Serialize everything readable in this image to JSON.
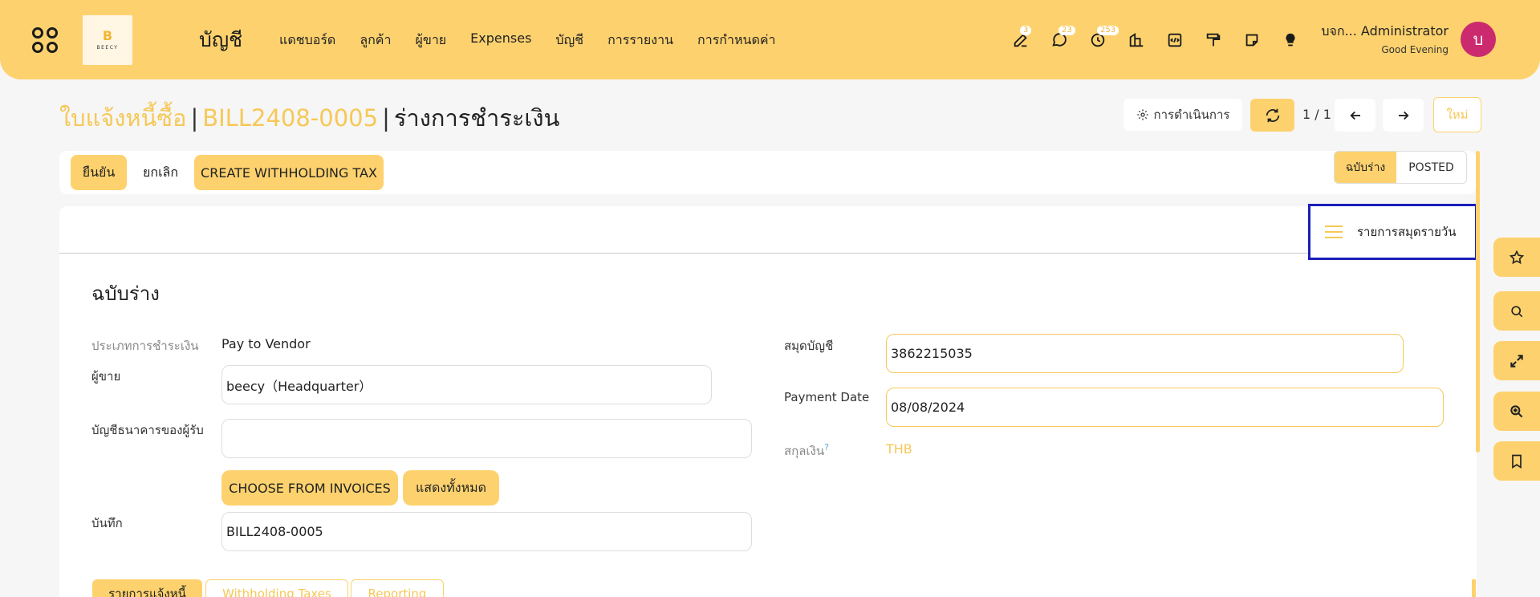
{
  "navbar": {
    "logo_text": "BEECY",
    "app_title": "บัญชี",
    "menu": [
      "แดชบอร์ด",
      "ลูกค้า",
      "ผู้ขาย",
      "Expenses",
      "บัญชี",
      "การรายงาน",
      "การกำหนดค่า"
    ],
    "icons": [
      {
        "name": "edit-note-icon",
        "badge": "3"
      },
      {
        "name": "chat-icon",
        "badge": "23"
      },
      {
        "name": "clock-icon",
        "badge": "253"
      },
      {
        "name": "building-icon",
        "badge": ""
      },
      {
        "name": "code-icon",
        "badge": ""
      },
      {
        "name": "paint-roller-icon",
        "badge": ""
      },
      {
        "name": "sticky-note-icon",
        "badge": ""
      },
      {
        "name": "lightbulb-icon",
        "badge": ""
      }
    ],
    "user_name": "บจก... Administrator",
    "greeting": "Good Evening",
    "avatar_letter": "บ",
    "accent": "#fdd26e",
    "avatar_color": "#cc2a6e"
  },
  "breadcrumb": {
    "item1": "ใบแจ้งหนี้ซื้อ",
    "item2": "BILL2408-0005",
    "current": "ร่างการชำระเงิน"
  },
  "controls": {
    "action_label": "การดำเนินการ",
    "pager": "1 / 1",
    "new_label": "ใหม่"
  },
  "statusbar": {
    "confirm": "ยืนยัน",
    "cancel": "ยกเลิก",
    "withholding": "CREATE WITHHOLDING TAX",
    "stage_draft": "ฉบับร่าง",
    "stage_posted": "POSTED"
  },
  "smart_button": "รายการสมุดรายวัน",
  "form": {
    "state_title": "ฉบับร่าง",
    "payment_type_label": "ประเภทการชำระเงิน",
    "payment_type_value": "Pay to Vendor",
    "vendor_label": "ผู้ขาย",
    "vendor_value": "beecy（Headquarter）",
    "bank_label": "บัญชีธนาคารของผู้รับ",
    "bank_value": "",
    "choose_invoices": "CHOOSE FROM INVOICES",
    "show_all": "แสดงทั้งหมด",
    "memo_label": "บันทึก",
    "memo_value": "BILL2408-0005",
    "journal_label": "สมุดบัญชี",
    "journal_value": "3862215035",
    "payment_date_label": "Payment Date",
    "payment_date_value": "08/08/2024",
    "currency_label": "สกุลเงิน",
    "currency_help": "?",
    "currency_value": "THB"
  },
  "tabs": [
    "รายการแจ้งหนี้",
    "Withholding Taxes",
    "Reporting"
  ]
}
